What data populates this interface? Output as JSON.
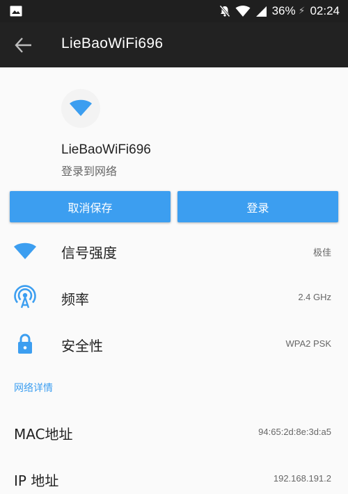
{
  "status_bar": {
    "battery": "36%",
    "time": "02:24",
    "icons": [
      "gallery-icon",
      "mute-icon",
      "wifi-signal-icon",
      "cell-signal-icon",
      "charging-icon"
    ]
  },
  "app_bar": {
    "title": "LieBaoWiFi696",
    "back_icon": "arrow-back-icon"
  },
  "network": {
    "name": "LieBaoWiFi696",
    "status": "登录到网络"
  },
  "buttons": {
    "forget": "取消保存",
    "login": "登录"
  },
  "rows": [
    {
      "label": "信号强度",
      "value": "极佳",
      "icon": "wifi-strength-icon"
    },
    {
      "label": "频率",
      "value": "2.4 GHz",
      "icon": "frequency-icon"
    },
    {
      "label": "安全性",
      "value": "WPA2 PSK",
      "icon": "lock-icon"
    }
  ],
  "details": {
    "section_title": "网络详情",
    "items": [
      {
        "label": "MAC地址",
        "value": "94:65:2d:8e:3d:a5"
      },
      {
        "label": "IP 地址",
        "value": "192.168.191.2"
      }
    ]
  },
  "colors": {
    "accent": "#3c9ef0",
    "app_bar": "#222222",
    "status_bar": "#1f1f1f",
    "background": "#fafafa"
  }
}
